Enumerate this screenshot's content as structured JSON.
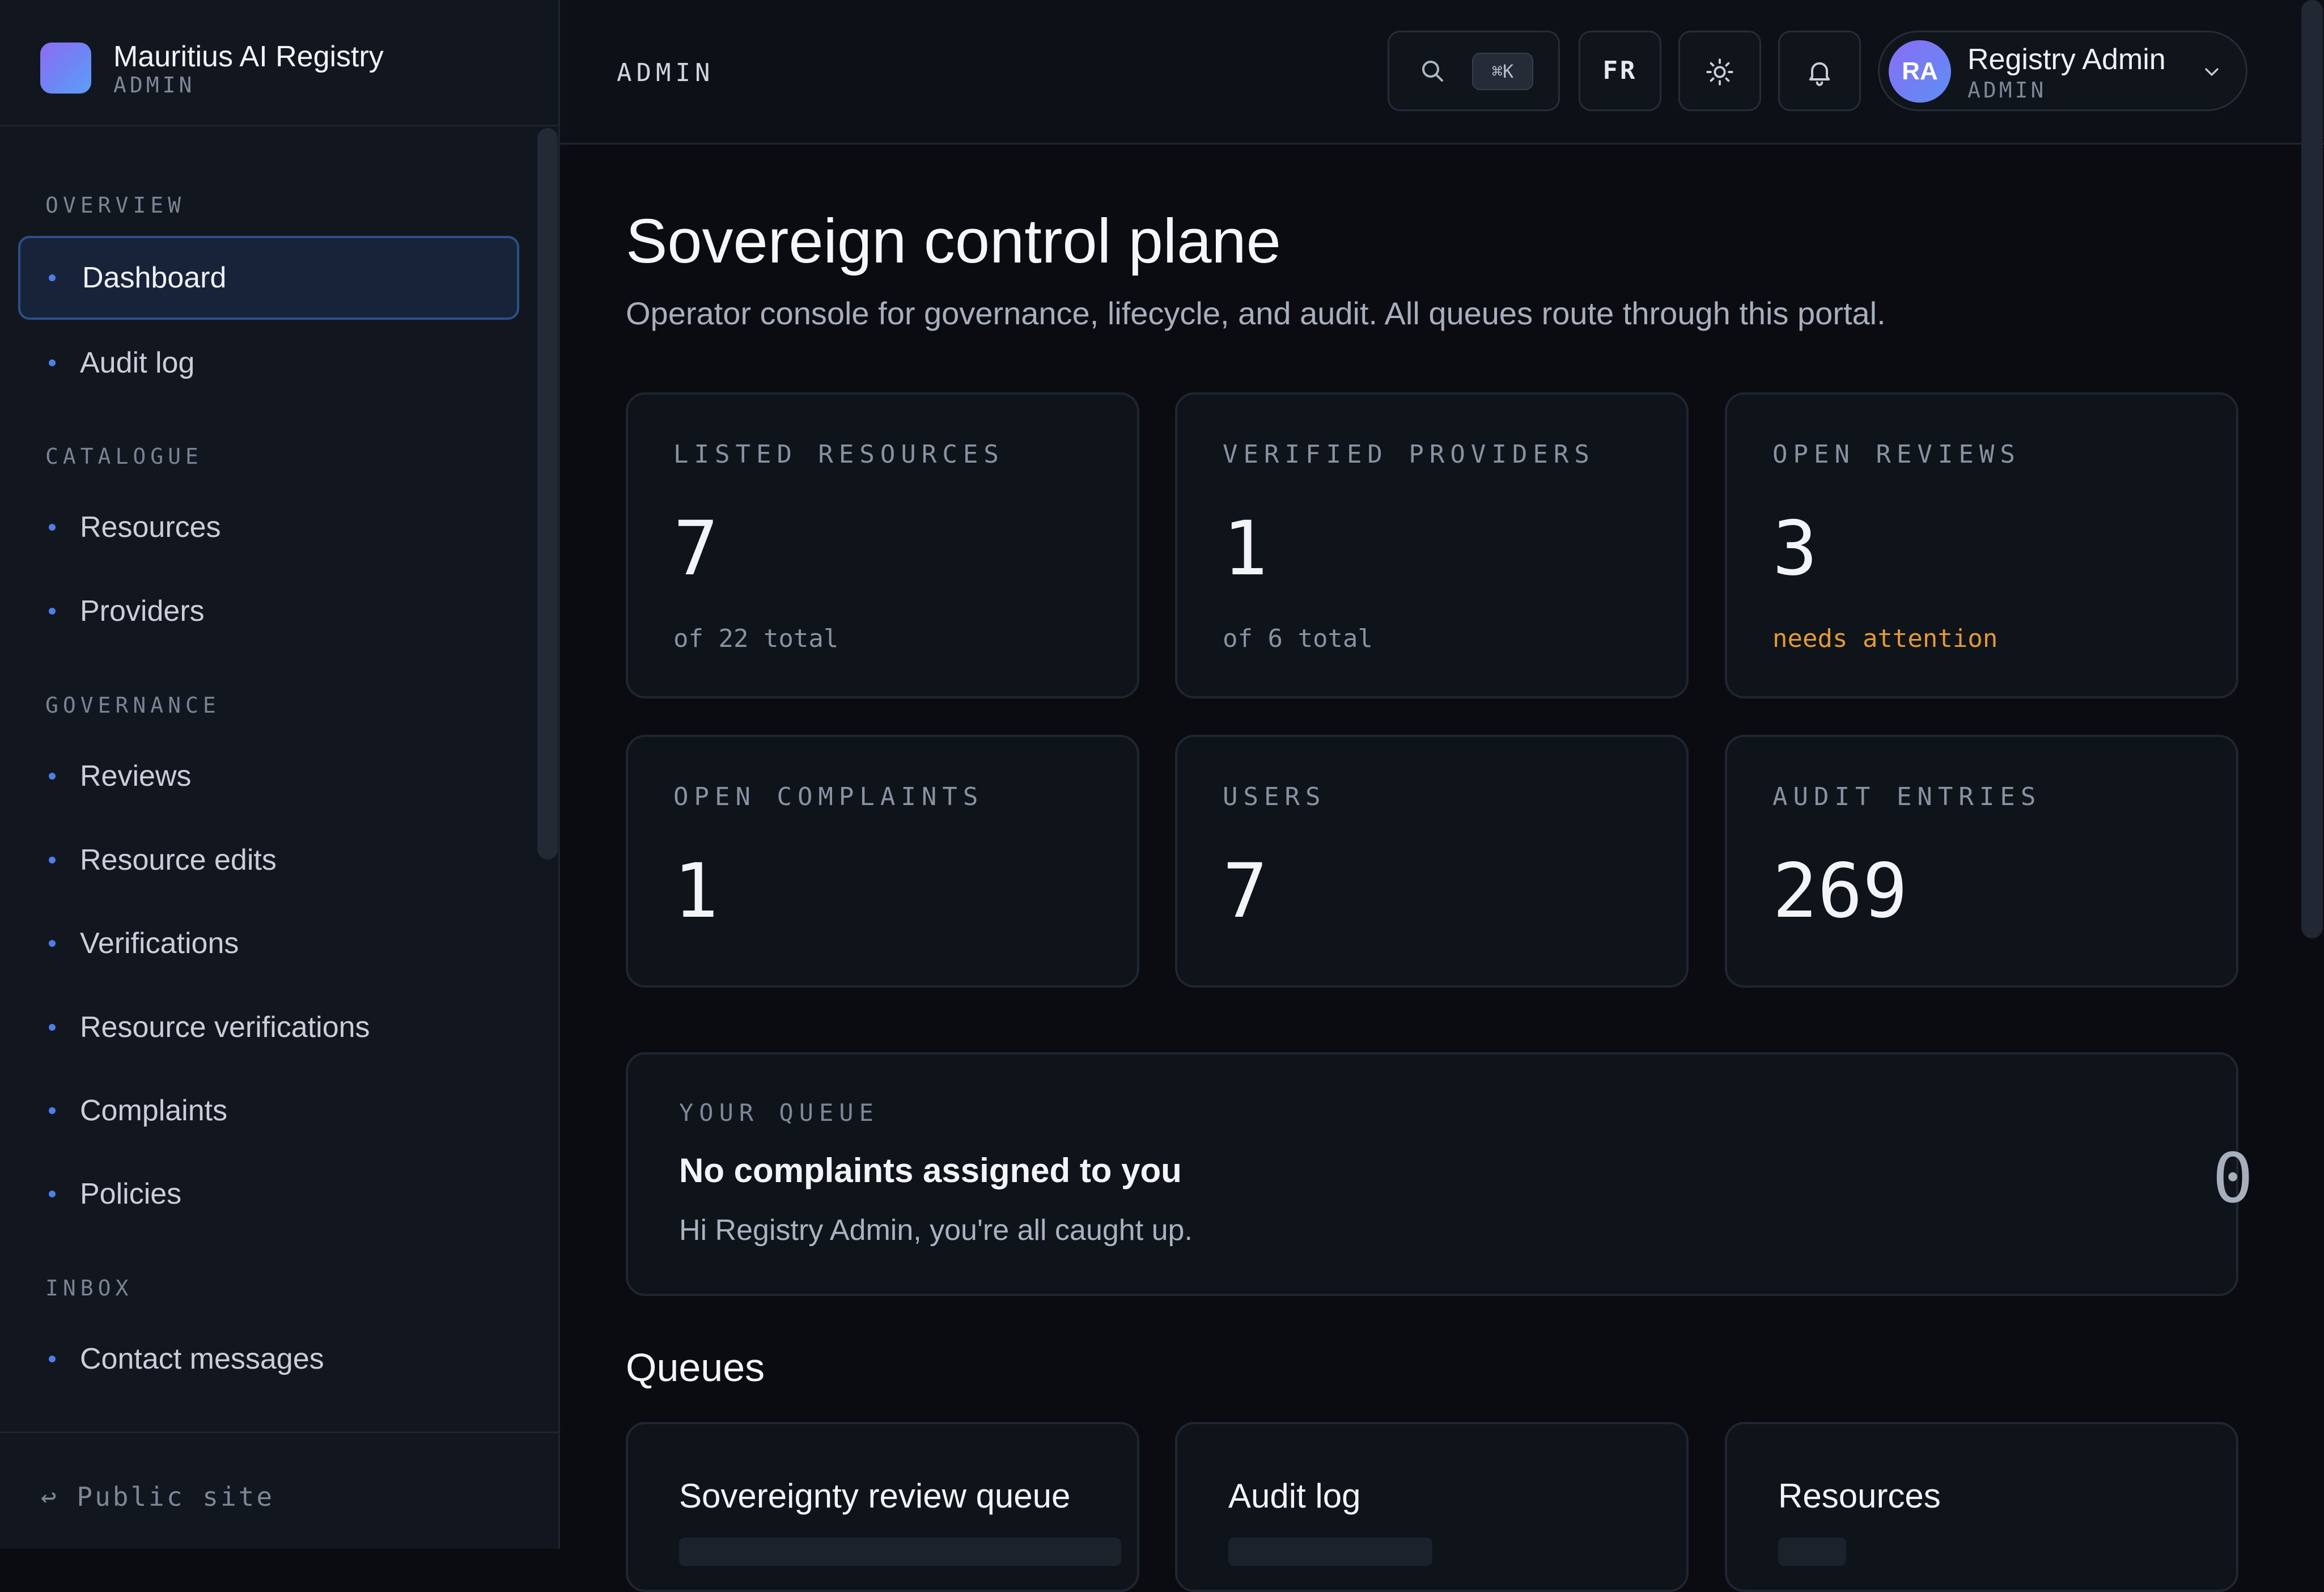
{
  "brand": {
    "title": "Mauritius AI Registry",
    "subtitle": "ADMIN"
  },
  "sidebar": {
    "sections": [
      {
        "title": "OVERVIEW",
        "items": [
          {
            "label": "Dashboard",
            "active": true
          },
          {
            "label": "Audit log"
          }
        ]
      },
      {
        "title": "CATALOGUE",
        "items": [
          {
            "label": "Resources"
          },
          {
            "label": "Providers"
          }
        ]
      },
      {
        "title": "GOVERNANCE",
        "items": [
          {
            "label": "Reviews"
          },
          {
            "label": "Resource edits"
          },
          {
            "label": "Verifications"
          },
          {
            "label": "Resource verifications"
          },
          {
            "label": "Complaints"
          },
          {
            "label": "Policies"
          }
        ]
      },
      {
        "title": "INBOX",
        "items": [
          {
            "label": "Contact messages"
          }
        ]
      }
    ],
    "footer_link": "↩ Public site"
  },
  "header": {
    "title": "ADMIN",
    "search_shortcut": "⌘K",
    "language": "FR",
    "user": {
      "initials": "RA",
      "name": "Registry Admin",
      "role": "ADMIN"
    }
  },
  "main": {
    "title": "Sovereign control plane",
    "subtitle": "Operator console for governance, lifecycle, and audit. All queues route through this portal.",
    "stats": [
      {
        "label": "LISTED RESOURCES",
        "value": "7",
        "note": "of 22 total"
      },
      {
        "label": "VERIFIED PROVIDERS",
        "value": "1",
        "note": "of 6 total"
      },
      {
        "label": "OPEN REVIEWS",
        "value": "3",
        "note": "needs attention"
      },
      {
        "label": "OPEN COMPLAINTS",
        "value": "1"
      },
      {
        "label": "USERS",
        "value": "7"
      },
      {
        "label": "AUDIT ENTRIES",
        "value": "269"
      }
    ],
    "your_queue": {
      "label": "YOUR QUEUE",
      "title": "No complaints assigned to you",
      "message": "Hi Registry Admin, you're all caught up.",
      "count": "0"
    },
    "queues_title": "Queues",
    "queues": [
      {
        "title": "Sovereignty review queue"
      },
      {
        "title": "Audit log"
      },
      {
        "title": "Resources"
      }
    ]
  },
  "colors": {
    "accent": "#4f7ee8",
    "warning": "#e39a2e",
    "background": "#0a0c11",
    "sidebar": "#12161f"
  },
  "icons": {
    "search": "search-icon",
    "theme": "sun-icon",
    "notifications": "bell-icon",
    "user_menu": "chevron-down-icon"
  }
}
